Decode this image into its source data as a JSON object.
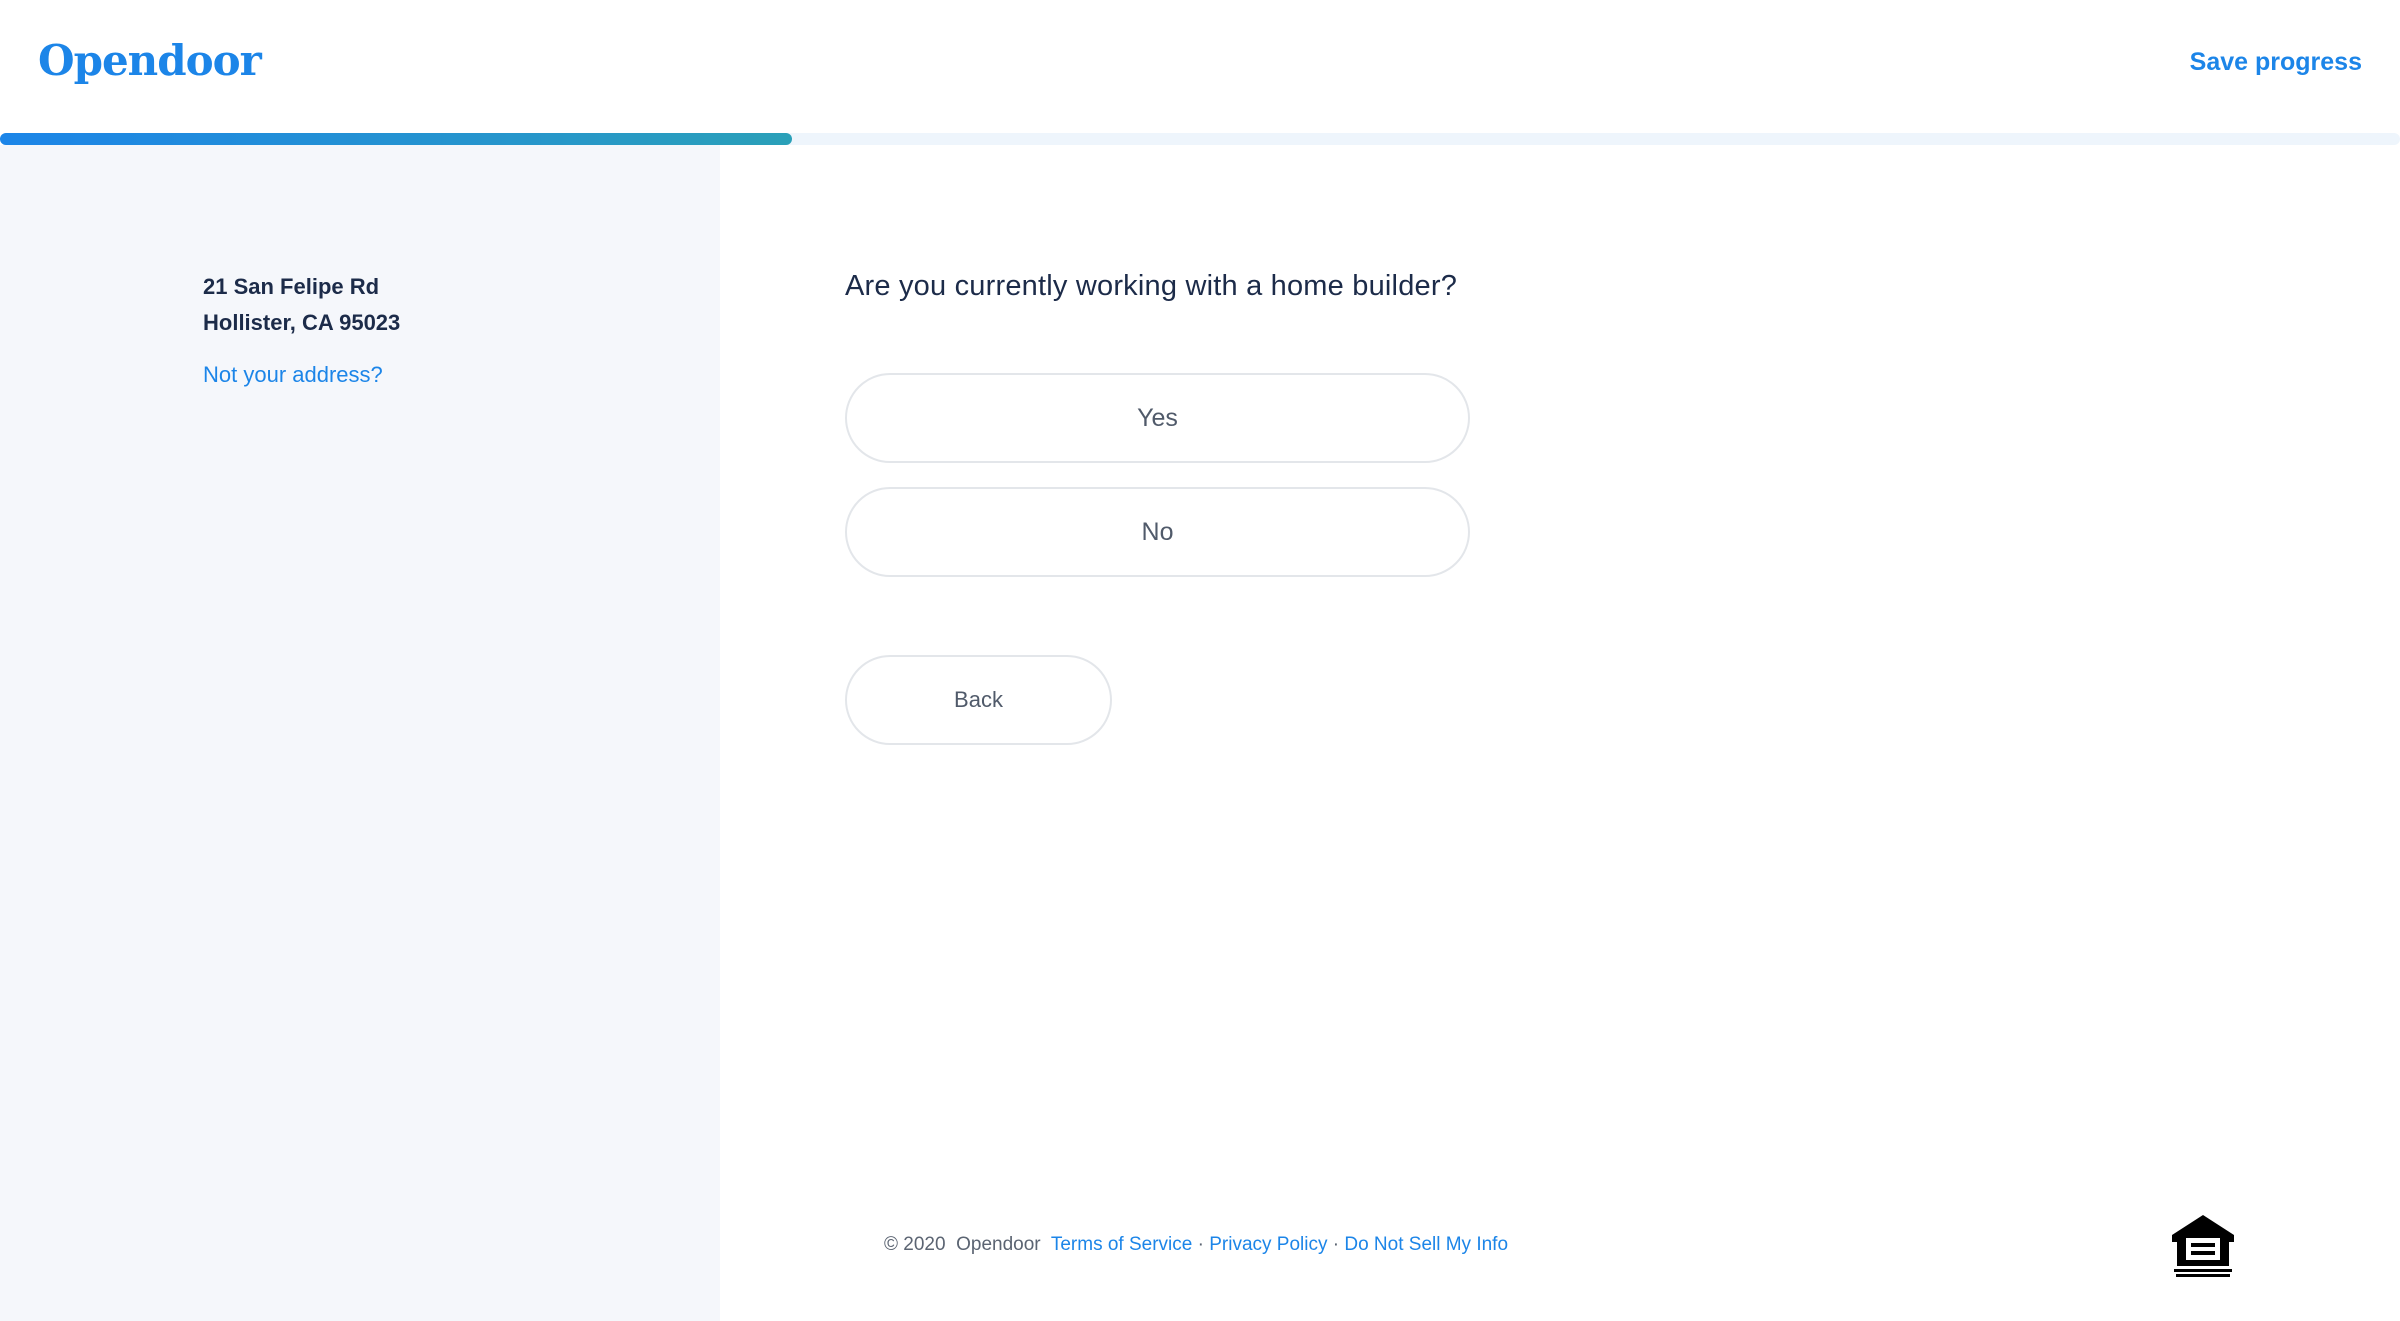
{
  "header": {
    "logo_text": "Opendoor",
    "save_progress": "Save progress"
  },
  "progress": {
    "fraction": 0.33
  },
  "sidebar": {
    "address_line1": "21 San Felipe Rd",
    "address_line2": "Hollister, CA 95023",
    "not_your_address": "Not your address?"
  },
  "main": {
    "question": "Are you currently working with a home builder?",
    "options": [
      {
        "label": "Yes"
      },
      {
        "label": "No"
      }
    ],
    "back_label": "Back"
  },
  "footer": {
    "copyright": "© 2020",
    "company": "Opendoor",
    "links": [
      {
        "label": "Terms of Service"
      },
      {
        "label": "Privacy Policy"
      },
      {
        "label": "Do Not Sell My Info"
      }
    ],
    "separator": " · ",
    "equal_housing_icon": "equal-housing-opportunity-icon"
  },
  "colors": {
    "brand_blue": "#1c85e8",
    "text_dark": "#1c2b49",
    "sidebar_bg": "#f5f7fb",
    "progress_track": "#eef5fc"
  }
}
